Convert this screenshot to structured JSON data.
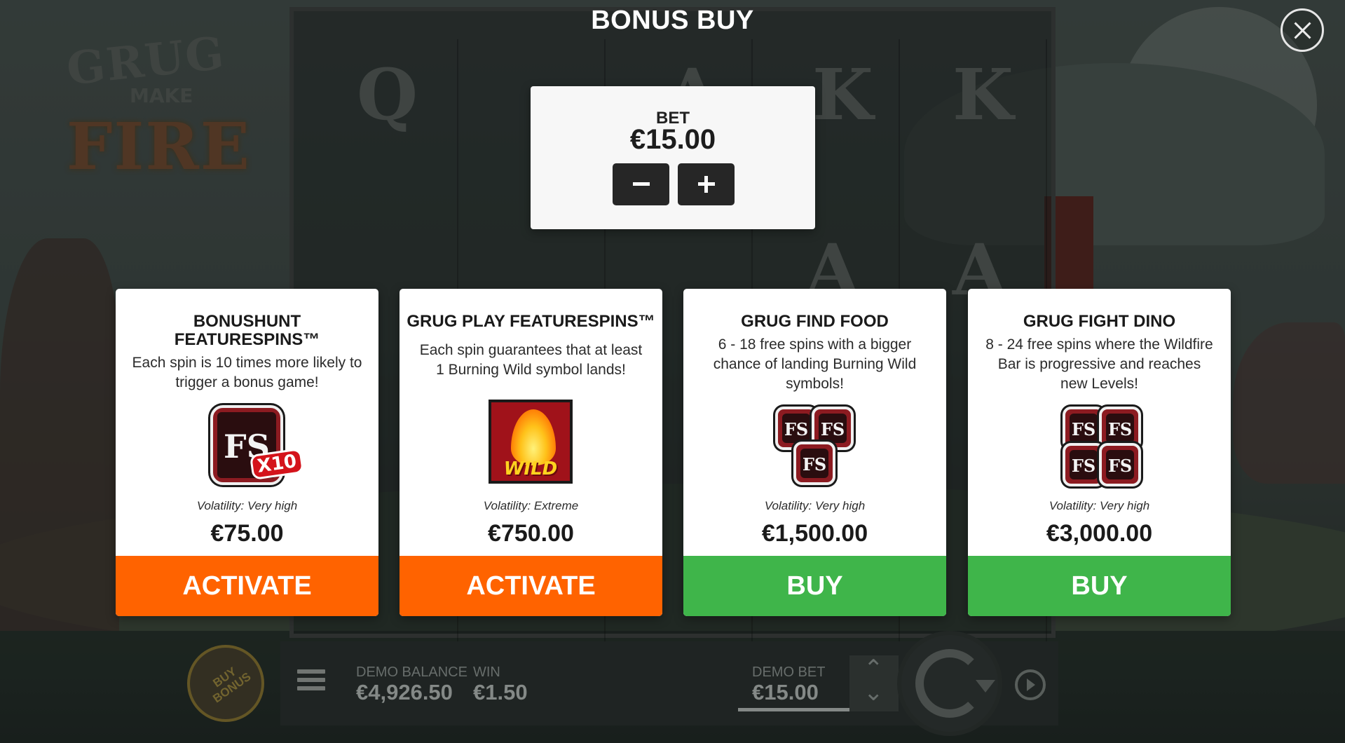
{
  "title": "BONUS BUY",
  "bet": {
    "label": "BET",
    "value": "€15.00"
  },
  "cards": [
    {
      "title": "BONUSHUNT FEATURESPINS™",
      "description": "Each spin is 10 times more likely to trigger a bonus game!",
      "icon": "featurespins-x10-icon",
      "icon_badge": "X10",
      "volatility": "Volatility: Very high",
      "price": "€75.00",
      "action": "ACTIVATE",
      "action_color": "#ff6300"
    },
    {
      "title": "GRUG PLAY FEATURESPINS™",
      "description": "Each spin guarantees that at least 1 Burning Wild symbol lands!",
      "icon": "burning-wild-icon",
      "icon_badge": "WILD",
      "volatility": "Volatility: Extreme",
      "price": "€750.00",
      "action": "ACTIVATE",
      "action_color": "#ff6300"
    },
    {
      "title": "GRUG FIND FOOD",
      "description": "6 - 18 free spins with a bigger chance of landing Burning Wild symbols!",
      "icon": "three-scatters-icon",
      "volatility": "Volatility: Very high",
      "price": "€1,500.00",
      "action": "BUY",
      "action_color": "#3fb54a"
    },
    {
      "title": "GRUG FIGHT DINO",
      "description": "8 - 24 free spins where the Wildfire Bar is progressive and reaches new Levels!",
      "icon": "four-scatters-icon",
      "volatility": "Volatility: Very high",
      "price": "€3,000.00",
      "action": "BUY",
      "action_color": "#3fb54a"
    }
  ],
  "game": {
    "logo_line1": "GRUG",
    "logo_line2": "MAKE",
    "logo_line3": "FIRE",
    "reel_symbols": [
      "Q",
      "A",
      "K",
      "K",
      "Q",
      "A",
      "A"
    ],
    "scatter_glyph": "FS"
  },
  "bottom_bar": {
    "buy_bonus": "BUY BONUS",
    "balance_label": "DEMO BALANCE",
    "balance_value": "€4,926.50",
    "win_label": "WIN",
    "win_value": "€1.50",
    "bet_label": "DEMO BET",
    "bet_value": "€15.00"
  }
}
